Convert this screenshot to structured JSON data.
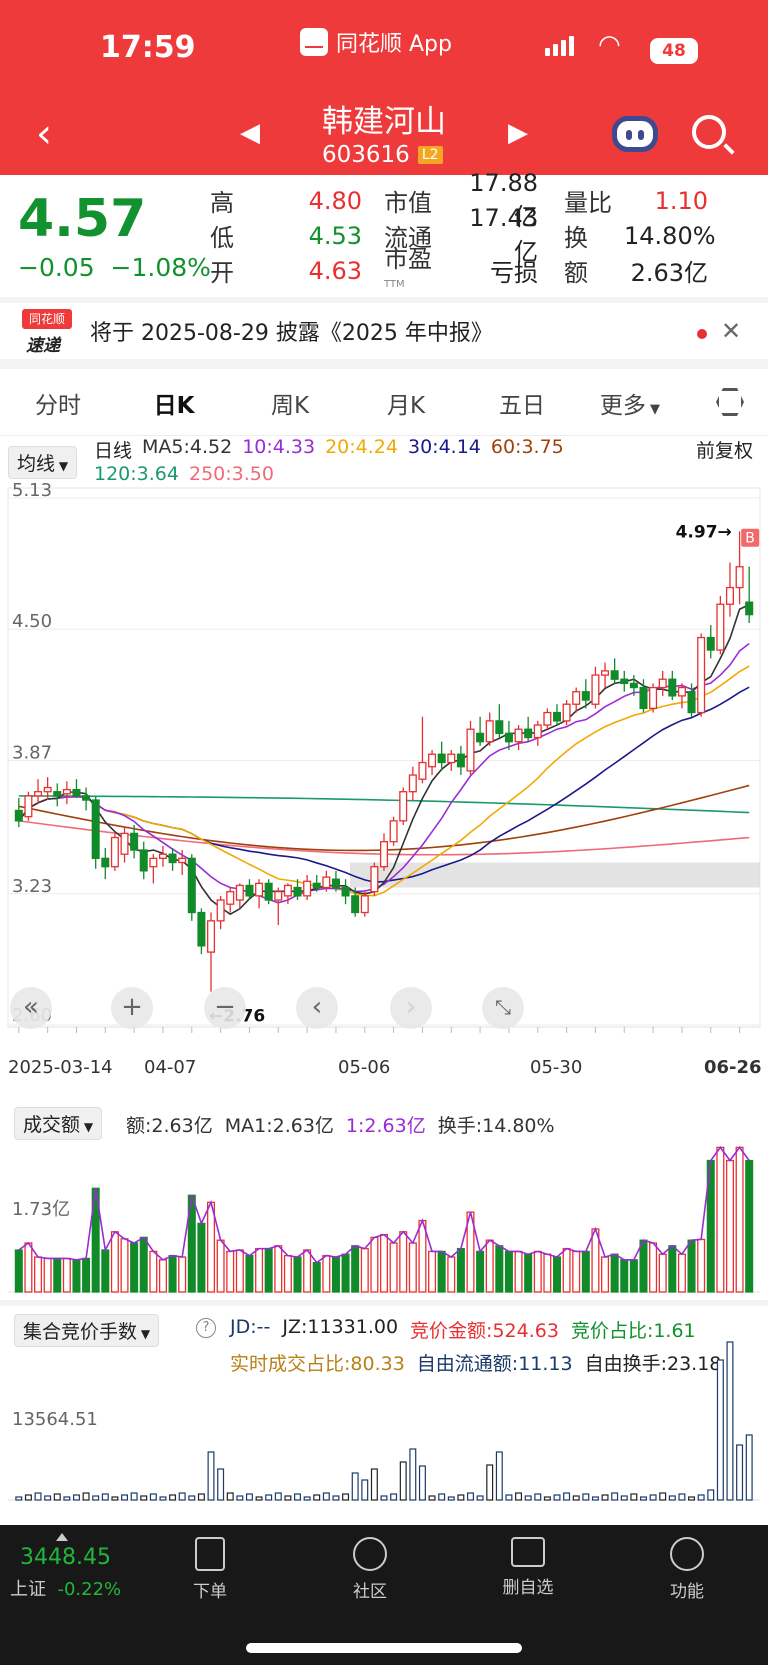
{
  "status_bar": {
    "time": "17:59",
    "app": "同花顺 App",
    "battery": "48"
  },
  "header": {
    "name": "韩建河山",
    "code": "603616",
    "level": "L2"
  },
  "quote": {
    "price": "4.57",
    "change": "−0.05",
    "change_pct": "−1.08%",
    "rows": [
      {
        "l1": "高",
        "v1": "4.80",
        "l2": "市值",
        "v2": "17.88亿",
        "l3": "量比",
        "v3": "1.10"
      },
      {
        "l1": "低",
        "v1": "4.53",
        "l2": "流通",
        "v2": "17.43亿",
        "l3": "换",
        "v3": "14.80%"
      },
      {
        "l1": "开",
        "v1": "4.63",
        "l2": "市盈",
        "v2": "亏损",
        "l3": "额",
        "v3": "2.63亿"
      }
    ],
    "pe_suffix": "TTM"
  },
  "notice": {
    "logo_top": "同花顺",
    "logo_bottom": "速递",
    "text": "将于 2025-08-29 披露《2025 年中报》"
  },
  "tabs": [
    "分时",
    "日K",
    "周K",
    "月K",
    "五日",
    "更多"
  ],
  "active_tab": "日K",
  "ma_bar": {
    "selector": "均线",
    "period": "日线",
    "fq": "前复权",
    "items": [
      {
        "label": "MA5:4.52",
        "color": "#333333"
      },
      {
        "label": "10:4.33",
        "color": "#9b2bd6"
      },
      {
        "label": "20:4.24",
        "color": "#f2a900"
      },
      {
        "label": "30:4.14",
        "color": "#1a1a8c"
      },
      {
        "label": "60:3.75",
        "color": "#a0400a"
      },
      {
        "label": "120:3.64",
        "color": "#1a9a6a"
      },
      {
        "label": "250:3.50",
        "color": "#f06a7a"
      }
    ]
  },
  "kline": {
    "y_labels": [
      "5.13",
      "4.50",
      "3.87",
      "3.23",
      "2.60"
    ],
    "high_label": "4.97→",
    "low_label": "←2.76",
    "b_mark": "B",
    "dates": [
      "2025-03-14",
      "04-07",
      "05-06",
      "05-30",
      "06-26"
    ]
  },
  "chart_data": {
    "type": "candlestick",
    "ylim": [
      2.6,
      5.13
    ],
    "ohlc": [
      [
        3.63,
        3.69,
        3.55,
        3.58
      ],
      [
        3.6,
        3.72,
        3.58,
        3.7
      ],
      [
        3.7,
        3.78,
        3.66,
        3.72
      ],
      [
        3.72,
        3.79,
        3.68,
        3.74
      ],
      [
        3.72,
        3.76,
        3.65,
        3.7
      ],
      [
        3.71,
        3.77,
        3.66,
        3.73
      ],
      [
        3.73,
        3.78,
        3.69,
        3.7
      ],
      [
        3.7,
        3.74,
        3.63,
        3.68
      ],
      [
        3.68,
        3.7,
        3.35,
        3.4
      ],
      [
        3.4,
        3.45,
        3.3,
        3.36
      ],
      [
        3.36,
        3.52,
        3.34,
        3.5
      ],
      [
        3.42,
        3.55,
        3.38,
        3.52
      ],
      [
        3.52,
        3.56,
        3.4,
        3.44
      ],
      [
        3.44,
        3.48,
        3.3,
        3.34
      ],
      [
        3.36,
        3.42,
        3.28,
        3.4
      ],
      [
        3.4,
        3.46,
        3.36,
        3.42
      ],
      [
        3.42,
        3.45,
        3.34,
        3.38
      ],
      [
        3.38,
        3.44,
        3.32,
        3.4
      ],
      [
        3.4,
        3.42,
        3.1,
        3.14
      ],
      [
        3.14,
        3.16,
        2.94,
        2.98
      ],
      [
        2.95,
        3.14,
        2.76,
        3.1
      ],
      [
        3.1,
        3.22,
        3.06,
        3.2
      ],
      [
        3.18,
        3.26,
        3.14,
        3.24
      ],
      [
        3.2,
        3.28,
        3.16,
        3.27
      ],
      [
        3.27,
        3.3,
        3.2,
        3.22
      ],
      [
        3.22,
        3.3,
        3.16,
        3.28
      ],
      [
        3.28,
        3.3,
        3.18,
        3.2
      ],
      [
        3.2,
        3.26,
        3.08,
        3.24
      ],
      [
        3.22,
        3.28,
        3.18,
        3.27
      ],
      [
        3.26,
        3.3,
        3.2,
        3.22
      ],
      [
        3.22,
        3.32,
        3.2,
        3.29
      ],
      [
        3.28,
        3.32,
        3.24,
        3.26
      ],
      [
        3.26,
        3.34,
        3.24,
        3.31
      ],
      [
        3.3,
        3.34,
        3.24,
        3.26
      ],
      [
        3.26,
        3.3,
        3.18,
        3.22
      ],
      [
        3.22,
        3.26,
        3.12,
        3.14
      ],
      [
        3.14,
        3.24,
        3.12,
        3.22
      ],
      [
        3.24,
        3.38,
        3.22,
        3.36
      ],
      [
        3.36,
        3.52,
        3.34,
        3.48
      ],
      [
        3.48,
        3.6,
        3.46,
        3.58
      ],
      [
        3.58,
        3.74,
        3.56,
        3.72
      ],
      [
        3.72,
        3.84,
        3.68,
        3.8
      ],
      [
        3.78,
        4.08,
        3.76,
        3.86
      ],
      [
        3.84,
        3.92,
        3.8,
        3.9
      ],
      [
        3.9,
        3.96,
        3.82,
        3.86
      ],
      [
        3.86,
        3.92,
        3.82,
        3.9
      ],
      [
        3.9,
        3.94,
        3.8,
        3.84
      ],
      [
        3.82,
        4.06,
        3.8,
        4.02
      ],
      [
        4.0,
        4.08,
        3.94,
        3.96
      ],
      [
        3.96,
        4.1,
        3.94,
        4.06
      ],
      [
        4.06,
        4.14,
        3.98,
        4.0
      ],
      [
        4.0,
        4.06,
        3.92,
        3.96
      ],
      [
        3.96,
        4.04,
        3.92,
        4.02
      ],
      [
        4.02,
        4.08,
        3.96,
        3.98
      ],
      [
        3.98,
        4.06,
        3.94,
        4.04
      ],
      [
        4.04,
        4.12,
        4.02,
        4.1
      ],
      [
        4.1,
        4.14,
        4.04,
        4.06
      ],
      [
        4.06,
        4.16,
        4.04,
        4.14
      ],
      [
        4.14,
        4.22,
        4.1,
        4.2
      ],
      [
        4.2,
        4.26,
        4.12,
        4.16
      ],
      [
        4.14,
        4.32,
        4.12,
        4.28
      ],
      [
        4.28,
        4.34,
        4.22,
        4.3
      ],
      [
        4.3,
        4.36,
        4.24,
        4.26
      ],
      [
        4.26,
        4.3,
        4.2,
        4.24
      ],
      [
        4.24,
        4.28,
        4.18,
        4.22
      ],
      [
        4.22,
        4.26,
        4.1,
        4.12
      ],
      [
        4.12,
        4.24,
        4.1,
        4.22
      ],
      [
        4.22,
        4.3,
        4.18,
        4.26
      ],
      [
        4.26,
        4.3,
        4.16,
        4.18
      ],
      [
        4.18,
        4.24,
        4.12,
        4.22
      ],
      [
        4.2,
        4.24,
        4.08,
        4.1
      ],
      [
        4.1,
        4.48,
        4.08,
        4.46
      ],
      [
        4.46,
        4.52,
        4.36,
        4.4
      ],
      [
        4.4,
        4.66,
        4.38,
        4.62
      ],
      [
        4.62,
        4.82,
        4.56,
        4.7
      ],
      [
        4.7,
        4.97,
        4.62,
        4.8
      ],
      [
        4.63,
        4.8,
        4.53,
        4.57
      ]
    ]
  },
  "volume": {
    "selector": "成交额",
    "labels": [
      {
        "t": "额:2.63亿",
        "c": "#333333"
      },
      {
        "t": "MA1:2.63亿",
        "c": "#333333"
      },
      {
        "t": "1:2.63亿",
        "c": "#9b2bd6"
      },
      {
        "t": "换手:14.80%",
        "c": "#333333"
      }
    ],
    "y_label": "1.73亿"
  },
  "auction": {
    "selector": "集合竞价手数",
    "labels": [
      {
        "t": "JD:--",
        "c": "#1a3a6a"
      },
      {
        "t": "JZ:11331.00",
        "c": "#222222"
      },
      {
        "t": "竞价金额:524.63",
        "c": "#e83030"
      },
      {
        "t": "竞价占比:1.61",
        "c": "#11922e"
      },
      {
        "t": "实时成交占比:80.33",
        "c": "#b8801a"
      },
      {
        "t": "自由流通额:11.13",
        "c": "#1a3a6a"
      },
      {
        "t": "自由换手:23.18",
        "c": "#222222"
      }
    ],
    "y_label": "13564.51"
  },
  "bottom_nav": {
    "index_value": "3448.45",
    "index_name": "上证",
    "index_change": "-0.22%",
    "items": [
      "下单",
      "社区",
      "删自选",
      "功能"
    ]
  }
}
